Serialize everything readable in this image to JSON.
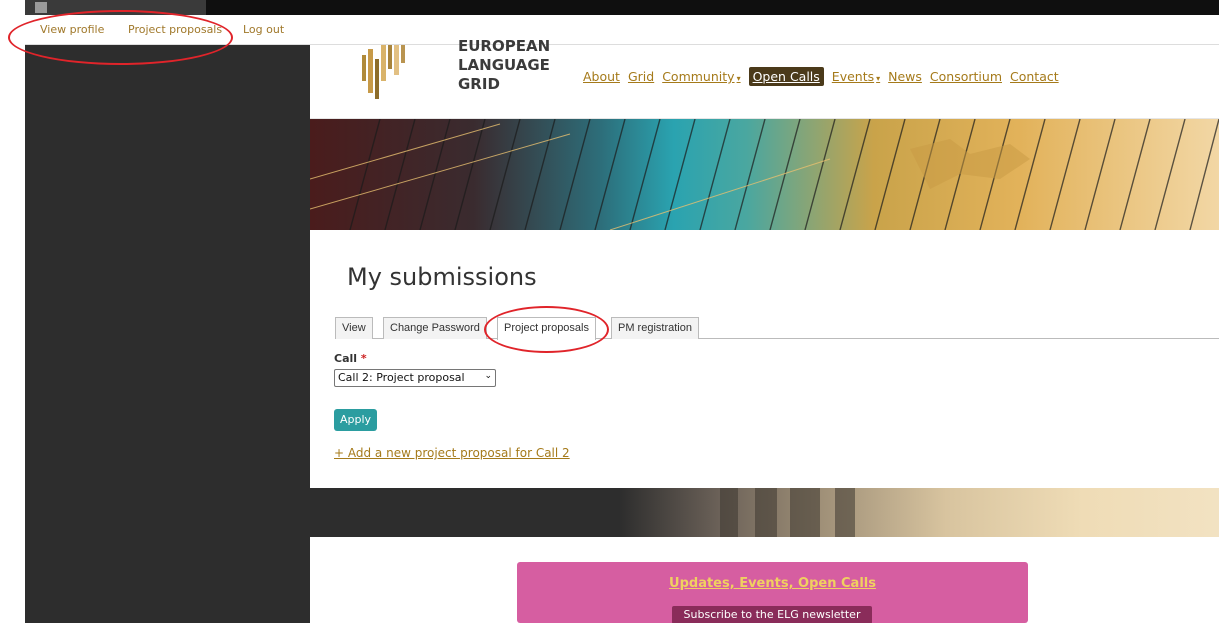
{
  "admin_toolbar": {
    "links": [
      "View profile",
      "Project proposals",
      "Log out"
    ]
  },
  "site": {
    "logo_lines": [
      "EUROPEAN",
      "LANGUAGE",
      "GRID"
    ],
    "nav": [
      {
        "label": "About",
        "dropdown": false,
        "active": false
      },
      {
        "label": "Grid",
        "dropdown": false,
        "active": false
      },
      {
        "label": "Community",
        "dropdown": true,
        "active": false
      },
      {
        "label": "Open Calls",
        "dropdown": false,
        "active": true
      },
      {
        "label": "Events",
        "dropdown": true,
        "active": false
      },
      {
        "label": "News",
        "dropdown": false,
        "active": false
      },
      {
        "label": "Consortium",
        "dropdown": false,
        "active": false
      },
      {
        "label": "Contact",
        "dropdown": false,
        "active": false
      }
    ]
  },
  "page": {
    "title": "My submissions",
    "tabs": [
      "View",
      "Change Password",
      "Project proposals",
      "PM registration"
    ],
    "active_tab": "Project proposals",
    "call_label": "Call",
    "required_marker": "*",
    "call_selected": "Call 2: Project proposal",
    "apply_label": "Apply",
    "add_link": "+ Add a new project proposal for Call 2"
  },
  "newsletter": {
    "title": "Updates, Events, Open Calls",
    "button": "Subscribe to the ELG newsletter"
  },
  "colors": {
    "accent_link": "#a57a1a",
    "apply_button": "#2b9da0",
    "active_nav": "#4b3a1a",
    "annotation": "#e0242a",
    "newsletter_bg": "#d65ea1"
  }
}
